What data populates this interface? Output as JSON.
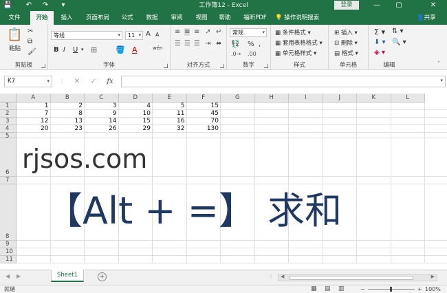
{
  "window": {
    "title": "工作簿12 - Excel",
    "login_label": "登录",
    "minimize": "—",
    "restore": "▢",
    "close": "✕"
  },
  "quick_access": {
    "save_icon": "💾",
    "undo_icon": "↶",
    "redo_icon": "↷",
    "more_icon": "▾"
  },
  "tabs": [
    "文件",
    "开始",
    "插入",
    "页面布局",
    "公式",
    "数据",
    "审阅",
    "视图",
    "帮助",
    "福昕PDF"
  ],
  "active_tab": "开始",
  "tell_me": "操作说明搜索",
  "share_label": "共享",
  "ribbon": {
    "clipboard": {
      "label": "剪贴板",
      "paste": "粘贴"
    },
    "font": {
      "label": "字体",
      "font_name": "等线",
      "font_size": "11",
      "bold": "B",
      "italic": "I",
      "underline": "U",
      "grow": "A",
      "shrink": "A",
      "font_color_glyph": "A",
      "phonetic": "wén"
    },
    "alignment": {
      "label": "对齐方式"
    },
    "number": {
      "label": "数字",
      "format": "常规",
      "percent": "%",
      "comma": ","
    },
    "styles": {
      "label": "样式",
      "conditional": "条件格式",
      "table": "套用表格格式",
      "cell_styles": "单元格样式"
    },
    "cells": {
      "label": "单元格",
      "insert": "插入",
      "delete": "删除",
      "format": "格式"
    },
    "editing": {
      "label": "编辑"
    }
  },
  "formula_bar": {
    "name_box": "K7",
    "cancel": "✕",
    "enter": "✓",
    "fx": "fx",
    "value": ""
  },
  "grid": {
    "columns": [
      "A",
      "B",
      "C",
      "D",
      "E",
      "F",
      "G",
      "H",
      "I",
      "J",
      "K",
      "L"
    ],
    "rows": [
      "1",
      "2",
      "3",
      "4",
      "5",
      "6",
      "7",
      "8",
      "9",
      "10",
      "11"
    ],
    "cells": [
      [
        "1",
        "2",
        "3",
        "4",
        "5",
        "15"
      ],
      [
        "7",
        "8",
        "9",
        "10",
        "11",
        "45"
      ],
      [
        "12",
        "13",
        "14",
        "15",
        "16",
        "70"
      ],
      [
        "20",
        "23",
        "26",
        "29",
        "32",
        "130"
      ]
    ],
    "watermark": "rjsos.com",
    "shortcut_text": "【Alt + =】 求和",
    "shortcut_color": "#1f3864"
  },
  "sheets": {
    "tabs": [
      "Sheet1"
    ],
    "add_label": "+"
  },
  "status": {
    "ready": "就绪",
    "zoom_minus": "−",
    "zoom_plus": "+",
    "zoom_level": "100%"
  },
  "colors": {
    "brand": "#217346",
    "ribbon_bg": "#f3f3f3",
    "header_bg": "#e6e6e6"
  }
}
